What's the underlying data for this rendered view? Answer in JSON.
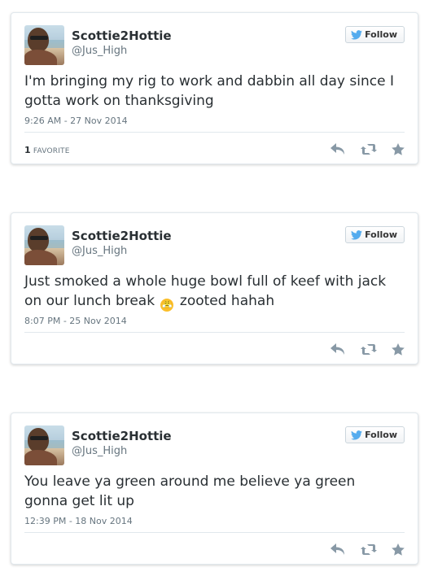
{
  "tweets": [
    {
      "name": "Scottie2Hottie",
      "handle": "@Jus_High",
      "follow_label": "Follow",
      "text": "I'm bringing my rig to work and dabbin all day since I gotta work on thanksgiving",
      "timestamp": "9:26 AM - 27 Nov 2014",
      "favorite_count": "1",
      "favorite_label": "FAVORITE"
    },
    {
      "name": "Scottie2Hottie",
      "handle": "@Jus_High",
      "follow_label": "Follow",
      "text_before_emoji": "Just smoked a whole huge bowl full of keef with jack on our lunch break",
      "emoji": "😤",
      "text_after_emoji": "zooted hahah",
      "timestamp": "8:07 PM - 25 Nov 2014"
    },
    {
      "name": "Scottie2Hottie",
      "handle": "@Jus_High",
      "follow_label": "Follow",
      "text": "You leave ya green around me believe ya green gonna get lit up",
      "timestamp": "12:39 PM - 18 Nov 2014"
    }
  ],
  "icons": {
    "follow": "twitter-bird-icon",
    "reply": "reply-icon",
    "retweet": "retweet-icon",
    "favorite": "star-icon"
  },
  "colors": {
    "twitter_blue": "#55acee",
    "action_gray": "#8899a6",
    "card_border": "#e1e8ed"
  }
}
